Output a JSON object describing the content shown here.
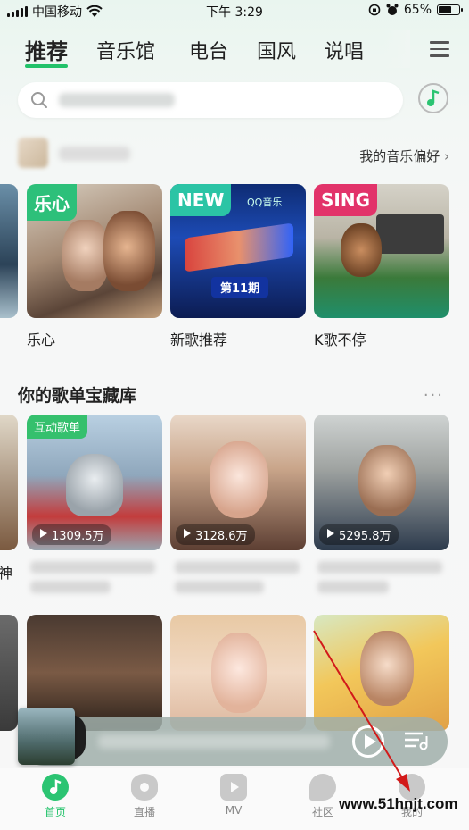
{
  "status_bar": {
    "carrier": "中国移动",
    "time": "下午 3:29",
    "battery": "65%",
    "battery_level": 0.65
  },
  "top_tabs": [
    "推荐",
    "音乐馆",
    "电台",
    "国风",
    "说唱"
  ],
  "search": {
    "placeholder": ""
  },
  "pref_link": "我的音乐偏好",
  "featured": [
    {
      "badge": "乐心",
      "title": "乐心"
    },
    {
      "badge": "NEW",
      "title": "新歌推荐",
      "cover_text": "第11期",
      "brand": "QQ音乐"
    },
    {
      "badge": "SING",
      "title": "K歌不停"
    }
  ],
  "section_playlists": {
    "title": "你的歌单宝藏库",
    "items": [
      {
        "tag": "互动歌单",
        "plays": "1309.5万"
      },
      {
        "plays": "3128.6万"
      },
      {
        "plays": "5295.8万"
      }
    ],
    "left_peek_text": "神"
  },
  "bottom_nav": [
    {
      "label": "首页",
      "icon": "music-note-icon",
      "active": true
    },
    {
      "label": "直播",
      "icon": "eye-icon",
      "active": false
    },
    {
      "label": "MV",
      "icon": "play-icon",
      "active": false
    },
    {
      "label": "社区",
      "icon": "chat-icon",
      "active": false
    },
    {
      "label": "我的",
      "icon": "profile-icon",
      "active": false
    }
  ],
  "watermark": "www.51hnjt.com",
  "colors": {
    "accent": "#22c26a"
  }
}
